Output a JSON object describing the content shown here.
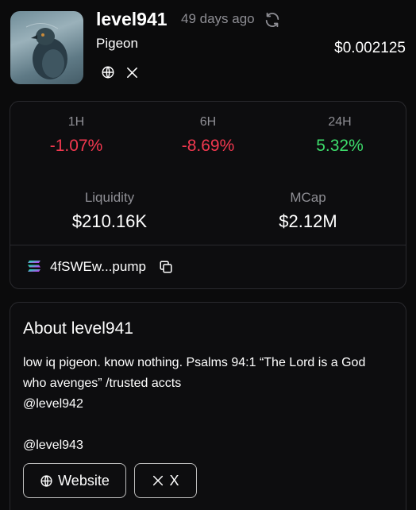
{
  "token": {
    "name": "level941",
    "age": "49 days ago",
    "subtitle": "Pigeon",
    "price": "$0.002125",
    "image_icon": "pigeon-photo"
  },
  "timeframes": [
    {
      "label": "1H",
      "change": "-1.07%",
      "direction": "down"
    },
    {
      "label": "6H",
      "change": "-8.69%",
      "direction": "down"
    },
    {
      "label": "24H",
      "change": "5.32%",
      "direction": "up"
    }
  ],
  "metrics": {
    "liquidity_label": "Liquidity",
    "liquidity_value": "$210.16K",
    "mcap_label": "MCap",
    "mcap_value": "$2.12M"
  },
  "contract": {
    "chain_icon": "solana-icon",
    "address": "4fSWEw...pump"
  },
  "about": {
    "title": "About level941",
    "description": "low iq pigeon. know nothing. Psalms 94:1 “The Lord is a God who avenges” /trusted accts\n@level942\n\n@level943",
    "website_label": "Website",
    "x_label": "X"
  },
  "colors": {
    "negative": "#f2384f",
    "positive": "#3ddc6b",
    "muted": "#8f8f95",
    "background": "#0b0b0c"
  }
}
